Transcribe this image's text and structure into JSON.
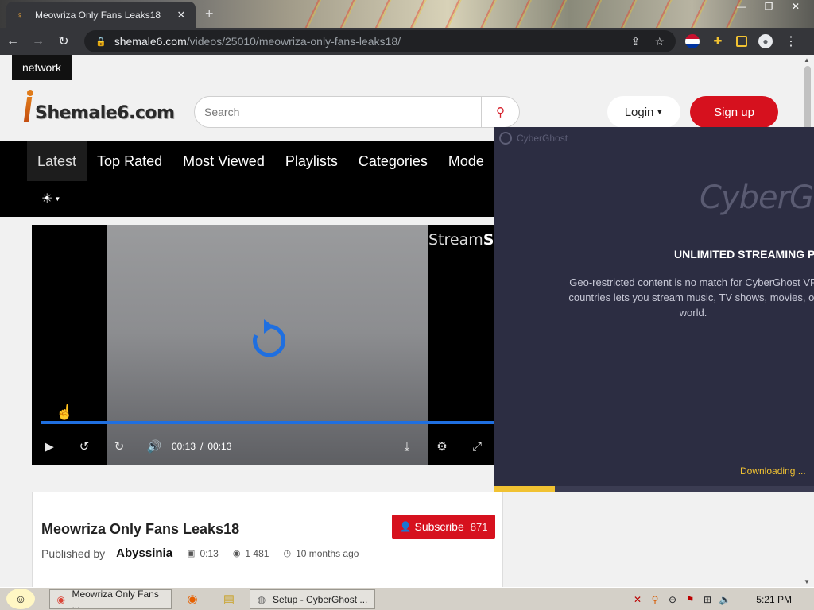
{
  "browser": {
    "tab_title": "Meowriza Only Fans Leaks18",
    "url_host": "shemale6.com",
    "url_path": "/videos/25010/meowriza-only-fans-leaks18/"
  },
  "site": {
    "network_label": "network",
    "logo_text": "Shemale6.com",
    "search_placeholder": "Search",
    "login_label": "Login",
    "signup_label": "Sign up",
    "nav": [
      "Latest",
      "Top Rated",
      "Most Viewed",
      "Playlists",
      "Categories",
      "Mode"
    ]
  },
  "player": {
    "watermark_a": "Stream",
    "watermark_b": "SE",
    "current_time": "00:13",
    "separator": "/",
    "duration": "00:13",
    "progress": 1.0
  },
  "video_info": {
    "title": "Meowriza Only Fans Leaks18",
    "subscribe_label": "Subscribe",
    "subscriber_count": "871",
    "published_by_label": "Published by",
    "author": "Abyssinia",
    "duration": "0:13",
    "views": "1 481",
    "age": "10 months ago"
  },
  "cyberghost": {
    "small_label": "CyberGhost",
    "brand": "CyberGho",
    "headline": "UNLIMITED STREAMING PO",
    "body_line1": "Geo-restricted content is no match for CyberGhost VP",
    "body_line2": "countries lets you stream music, TV shows, movies, or",
    "body_line3": "world.",
    "status": "Downloading ...",
    "progress": 0.19
  },
  "taskbar": {
    "task_chrome": "Meowriza Only Fans ...",
    "task_setup": "Setup - CyberGhost ...",
    "clock": "5:21 PM"
  },
  "colors": {
    "accent_red": "#d6111e",
    "player_blue": "#1f6fe0",
    "cg_background": "#2c2d42",
    "cg_yellow": "#f1c232"
  }
}
